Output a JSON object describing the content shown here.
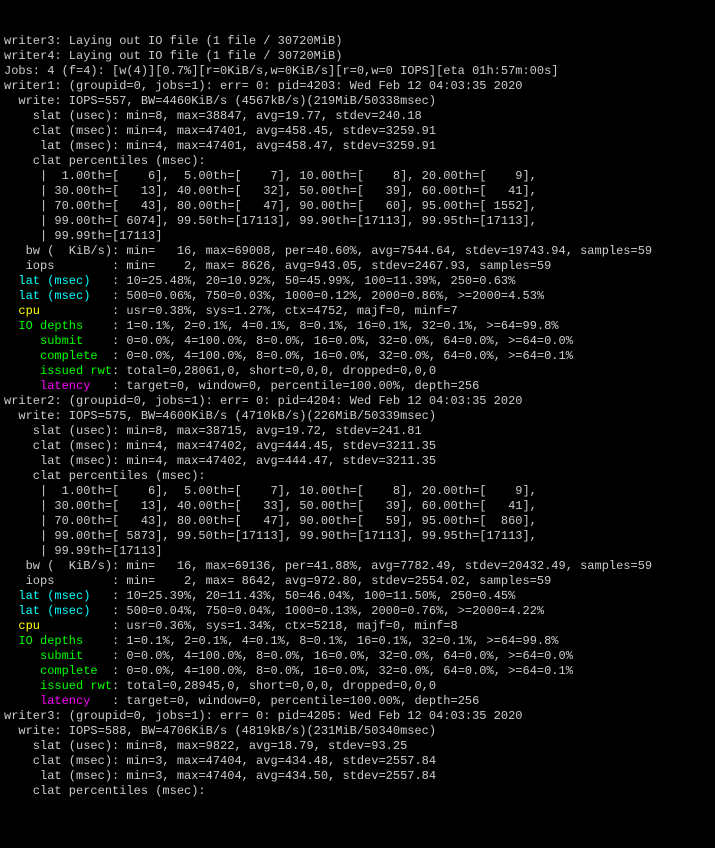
{
  "lines": [
    {
      "segments": [
        {
          "c": "gray",
          "t": "writer3: Laying out IO file (1 file / 30720MiB)"
        }
      ]
    },
    {
      "segments": [
        {
          "c": "gray",
          "t": "writer4: Laying out IO file (1 file / 30720MiB)"
        }
      ]
    },
    {
      "segments": [
        {
          "c": "gray",
          "t": "Jobs: 4 (f=4): [w(4)][0.7%][r=0KiB/s,w=0KiB/s][r=0,w=0 IOPS][eta 01h:57m:00s]"
        }
      ]
    },
    {
      "segments": [
        {
          "c": "gray",
          "t": "writer1: (groupid=0, jobs=1): err= 0: pid=4203: Wed Feb 12 04:03:35 2020"
        }
      ]
    },
    {
      "segments": [
        {
          "c": "gray",
          "t": "  write: IOPS=557, BW=4460KiB/s (4567kB/s)(219MiB/50338msec)"
        }
      ]
    },
    {
      "segments": [
        {
          "c": "gray",
          "t": "    slat (usec): min=8, max=38847, avg=19.77, stdev=240.18"
        }
      ]
    },
    {
      "segments": [
        {
          "c": "gray",
          "t": "    clat (msec): min=4, max=47401, avg=458.45, stdev=3259.91"
        }
      ]
    },
    {
      "segments": [
        {
          "c": "gray",
          "t": "     lat (msec): min=4, max=47401, avg=458.47, stdev=3259.91"
        }
      ]
    },
    {
      "segments": [
        {
          "c": "gray",
          "t": "    clat percentiles (msec):"
        }
      ]
    },
    {
      "segments": [
        {
          "c": "gray",
          "t": "     |  1.00th=[    6],  5.00th=[    7], 10.00th=[    8], 20.00th=[    9],"
        }
      ]
    },
    {
      "segments": [
        {
          "c": "gray",
          "t": "     | 30.00th=[   13], 40.00th=[   32], 50.00th=[   39], 60.00th=[   41],"
        }
      ]
    },
    {
      "segments": [
        {
          "c": "gray",
          "t": "     | 70.00th=[   43], 80.00th=[   47], 90.00th=[   60], 95.00th=[ 1552],"
        }
      ]
    },
    {
      "segments": [
        {
          "c": "gray",
          "t": "     | 99.00th=[ 6074], 99.50th=[17113], 99.90th=[17113], 99.95th=[17113],"
        }
      ]
    },
    {
      "segments": [
        {
          "c": "gray",
          "t": "     | 99.99th=[17113]"
        }
      ]
    },
    {
      "segments": [
        {
          "c": "gray",
          "t": "   bw (  KiB/s): min=   16, max=69008, per=40.60%, avg=7544.64, stdev=19743.94, samples=59"
        }
      ]
    },
    {
      "segments": [
        {
          "c": "gray",
          "t": "   iops        : min=    2, max= 8626, avg=943.05, stdev=2467.93, samples=59"
        }
      ]
    },
    {
      "segments": [
        {
          "c": "cyan",
          "t": "  lat (msec)   "
        },
        {
          "c": "gray",
          "t": ": 10=25.48%, 20=10.92%, 50=45.99%, 100=11.39%, 250=0.63%"
        }
      ]
    },
    {
      "segments": [
        {
          "c": "cyan",
          "t": "  lat (msec)   "
        },
        {
          "c": "gray",
          "t": ": 500=0.06%, 750=0.03%, 1000=0.12%, 2000=0.86%, >=2000=4.53%"
        }
      ]
    },
    {
      "segments": [
        {
          "c": "yellow",
          "t": "  cpu          "
        },
        {
          "c": "gray",
          "t": ": usr=0.38%, sys=1.27%, ctx=4752, majf=0, minf=7"
        }
      ]
    },
    {
      "segments": [
        {
          "c": "green",
          "t": "  IO depths    "
        },
        {
          "c": "gray",
          "t": ": 1=0.1%, 2=0.1%, 4=0.1%, 8=0.1%, 16=0.1%, 32=0.1%, >=64=99.8%"
        }
      ]
    },
    {
      "segments": [
        {
          "c": "green",
          "t": "     submit    "
        },
        {
          "c": "gray",
          "t": ": 0=0.0%, 4=100.0%, 8=0.0%, 16=0.0%, 32=0.0%, 64=0.0%, >=64=0.0%"
        }
      ]
    },
    {
      "segments": [
        {
          "c": "green",
          "t": "     complete  "
        },
        {
          "c": "gray",
          "t": ": 0=0.0%, 4=100.0%, 8=0.0%, 16=0.0%, 32=0.0%, 64=0.0%, >=64=0.1%"
        }
      ]
    },
    {
      "segments": [
        {
          "c": "green",
          "t": "     issued rwt"
        },
        {
          "c": "gray",
          "t": ": total=0,28061,0, short=0,0,0, dropped=0,0,0"
        }
      ]
    },
    {
      "segments": [
        {
          "c": "magenta",
          "t": "     latency   "
        },
        {
          "c": "gray",
          "t": ": target=0, window=0, percentile=100.00%, depth=256"
        }
      ]
    },
    {
      "segments": [
        {
          "c": "gray",
          "t": "writer2: (groupid=0, jobs=1): err= 0: pid=4204: Wed Feb 12 04:03:35 2020"
        }
      ]
    },
    {
      "segments": [
        {
          "c": "gray",
          "t": "  write: IOPS=575, BW=4600KiB/s (4710kB/s)(226MiB/50339msec)"
        }
      ]
    },
    {
      "segments": [
        {
          "c": "gray",
          "t": "    slat (usec): min=8, max=38715, avg=19.72, stdev=241.81"
        }
      ]
    },
    {
      "segments": [
        {
          "c": "gray",
          "t": "    clat (msec): min=4, max=47402, avg=444.45, stdev=3211.35"
        }
      ]
    },
    {
      "segments": [
        {
          "c": "gray",
          "t": "     lat (msec): min=4, max=47402, avg=444.47, stdev=3211.35"
        }
      ]
    },
    {
      "segments": [
        {
          "c": "gray",
          "t": "    clat percentiles (msec):"
        }
      ]
    },
    {
      "segments": [
        {
          "c": "gray",
          "t": "     |  1.00th=[    6],  5.00th=[    7], 10.00th=[    8], 20.00th=[    9],"
        }
      ]
    },
    {
      "segments": [
        {
          "c": "gray",
          "t": "     | 30.00th=[   13], 40.00th=[   33], 50.00th=[   39], 60.00th=[   41],"
        }
      ]
    },
    {
      "segments": [
        {
          "c": "gray",
          "t": "     | 70.00th=[   43], 80.00th=[   47], 90.00th=[   59], 95.00th=[  860],"
        }
      ]
    },
    {
      "segments": [
        {
          "c": "gray",
          "t": "     | 99.00th=[ 5873], 99.50th=[17113], 99.90th=[17113], 99.95th=[17113],"
        }
      ]
    },
    {
      "segments": [
        {
          "c": "gray",
          "t": "     | 99.99th=[17113]"
        }
      ]
    },
    {
      "segments": [
        {
          "c": "gray",
          "t": "   bw (  KiB/s): min=   16, max=69136, per=41.88%, avg=7782.49, stdev=20432.49, samples=59"
        }
      ]
    },
    {
      "segments": [
        {
          "c": "gray",
          "t": "   iops        : min=    2, max= 8642, avg=972.80, stdev=2554.02, samples=59"
        }
      ]
    },
    {
      "segments": [
        {
          "c": "cyan",
          "t": "  lat (msec)   "
        },
        {
          "c": "gray",
          "t": ": 10=25.39%, 20=11.43%, 50=46.04%, 100=11.50%, 250=0.45%"
        }
      ]
    },
    {
      "segments": [
        {
          "c": "cyan",
          "t": "  lat (msec)   "
        },
        {
          "c": "gray",
          "t": ": 500=0.04%, 750=0.04%, 1000=0.13%, 2000=0.76%, >=2000=4.22%"
        }
      ]
    },
    {
      "segments": [
        {
          "c": "yellow",
          "t": "  cpu          "
        },
        {
          "c": "gray",
          "t": ": usr=0.36%, sys=1.34%, ctx=5218, majf=0, minf=8"
        }
      ]
    },
    {
      "segments": [
        {
          "c": "green",
          "t": "  IO depths    "
        },
        {
          "c": "gray",
          "t": ": 1=0.1%, 2=0.1%, 4=0.1%, 8=0.1%, 16=0.1%, 32=0.1%, >=64=99.8%"
        }
      ]
    },
    {
      "segments": [
        {
          "c": "green",
          "t": "     submit    "
        },
        {
          "c": "gray",
          "t": ": 0=0.0%, 4=100.0%, 8=0.0%, 16=0.0%, 32=0.0%, 64=0.0%, >=64=0.0%"
        }
      ]
    },
    {
      "segments": [
        {
          "c": "green",
          "t": "     complete  "
        },
        {
          "c": "gray",
          "t": ": 0=0.0%, 4=100.0%, 8=0.0%, 16=0.0%, 32=0.0%, 64=0.0%, >=64=0.1%"
        }
      ]
    },
    {
      "segments": [
        {
          "c": "green",
          "t": "     issued rwt"
        },
        {
          "c": "gray",
          "t": ": total=0,28945,0, short=0,0,0, dropped=0,0,0"
        }
      ]
    },
    {
      "segments": [
        {
          "c": "magenta",
          "t": "     latency   "
        },
        {
          "c": "gray",
          "t": ": target=0, window=0, percentile=100.00%, depth=256"
        }
      ]
    },
    {
      "segments": [
        {
          "c": "gray",
          "t": "writer3: (groupid=0, jobs=1): err= 0: pid=4205: Wed Feb 12 04:03:35 2020"
        }
      ]
    },
    {
      "segments": [
        {
          "c": "gray",
          "t": "  write: IOPS=588, BW=4706KiB/s (4819kB/s)(231MiB/50340msec)"
        }
      ]
    },
    {
      "segments": [
        {
          "c": "gray",
          "t": "    slat (usec): min=8, max=9822, avg=18.79, stdev=93.25"
        }
      ]
    },
    {
      "segments": [
        {
          "c": "gray",
          "t": "    clat (msec): min=3, max=47404, avg=434.48, stdev=2557.84"
        }
      ]
    },
    {
      "segments": [
        {
          "c": "gray",
          "t": "     lat (msec): min=3, max=47404, avg=434.50, stdev=2557.84"
        }
      ]
    },
    {
      "segments": [
        {
          "c": "gray",
          "t": "    clat percentiles (msec):"
        }
      ]
    }
  ]
}
